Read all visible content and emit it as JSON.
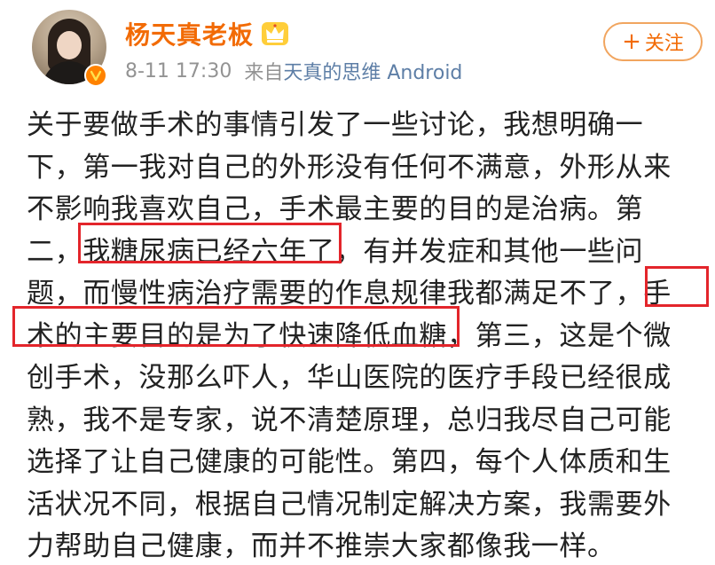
{
  "post": {
    "author": {
      "name": "杨天真老板",
      "avatar_icon": "avatar-photo",
      "verified_badge_icon": "verified-v-icon",
      "crown_icon": "crown-icon"
    },
    "meta": {
      "time": "8-11 17:30",
      "source_prefix": "来自",
      "source": "天真的思维 Android"
    },
    "follow_button": {
      "plus": "+",
      "label": "关注"
    },
    "content_lines": [
      "关于要做手术的事情引发了一些讨论，我想明确一",
      "下，第一我对自己的外形没有任何不满意，外形从来",
      "不影响我喜欢自己，手术最主要的目的是治病。第",
      "二，我糖尿病已经六年了，有并发症和其他一些问",
      "题，而慢性病治疗需要的作息规律我都满足不了，手",
      "术的主要目的是为了快速降低血糖，第三，这是个微",
      "创手术，没那么吓人，华山医院的医疗手段已经很成",
      "熟，我不是专家，说不清楚原理，总归我尽自己可能",
      "选择了让自己健康的可能性。第四，每个人体质和生",
      "活状况不同，根据自己情况制定解决方案，我需要外",
      "力帮助自己健康，而并不推崇大家都像我一样。"
    ],
    "colors": {
      "username": "#f26b05",
      "source_link": "#5d7ea6",
      "highlight_box": "#e3252b",
      "body_text": "#222222"
    }
  }
}
